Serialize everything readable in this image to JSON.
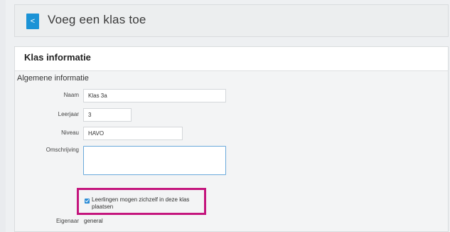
{
  "header": {
    "back_glyph": "<",
    "title": "Voeg een klas toe"
  },
  "panel": {
    "title": "Klas informatie",
    "section": "Algemene informatie",
    "fields": {
      "naam": {
        "label": "Naam",
        "value": "Klas 3a"
      },
      "leerjaar": {
        "label": "Leerjaar",
        "value": "3"
      },
      "niveau": {
        "label": "Niveau",
        "value": "HAVO"
      },
      "omschrijving": {
        "label": "Omschrijving",
        "value": ""
      }
    },
    "self_enroll": {
      "checked": true,
      "label": "Leerlingen mogen zichzelf in deze klas plaatsen"
    },
    "owner": {
      "label": "Eigenaar",
      "value": "general"
    }
  },
  "colors": {
    "accent": "#1b93d6",
    "highlight": "#c4157d",
    "focus_border": "#6aa9db"
  }
}
